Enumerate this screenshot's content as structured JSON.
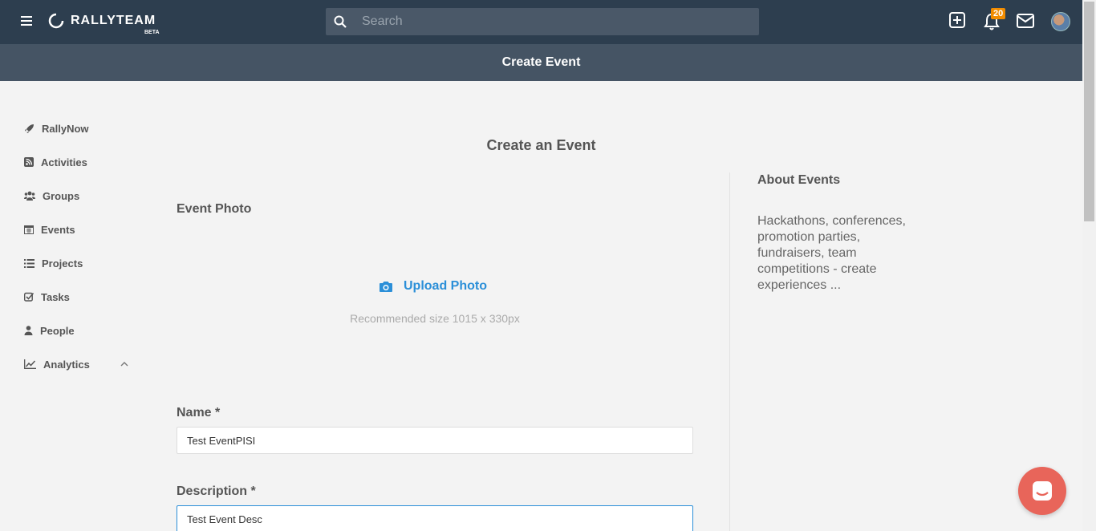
{
  "topbar": {
    "logo_text": "RALLYTEAM",
    "logo_beta": "BETA",
    "search_placeholder": "Search",
    "notification_count": "20"
  },
  "subheader": {
    "title": "Create Event"
  },
  "sidebar": {
    "items": [
      {
        "label": "RallyNow",
        "icon": "rocket-icon"
      },
      {
        "label": "Activities",
        "icon": "rss-icon"
      },
      {
        "label": "Groups",
        "icon": "users-icon"
      },
      {
        "label": "Events",
        "icon": "calendar-icon"
      },
      {
        "label": "Projects",
        "icon": "list-icon"
      },
      {
        "label": "Tasks",
        "icon": "checkbox-icon"
      },
      {
        "label": "People",
        "icon": "user-icon"
      },
      {
        "label": "Analytics",
        "icon": "chart-icon"
      }
    ]
  },
  "main": {
    "title": "Create an Event",
    "photo_label": "Event Photo",
    "upload_label": "Upload Photo",
    "recommended": "Recommended size 1015 x 330px",
    "name_label": "Name *",
    "name_value": "Test EventPISI",
    "description_label": "Description *",
    "description_value": "Test Event Desc"
  },
  "about": {
    "title": "About Events",
    "text": "Hackathons, conferences, promotion parties, fundraisers, team competitions - create experiences ..."
  },
  "colors": {
    "topbar": "#2d3e4f",
    "subheader": "#455464",
    "accent": "#2b8fd8",
    "badge": "#f28c00",
    "chat": "#e8655a"
  }
}
